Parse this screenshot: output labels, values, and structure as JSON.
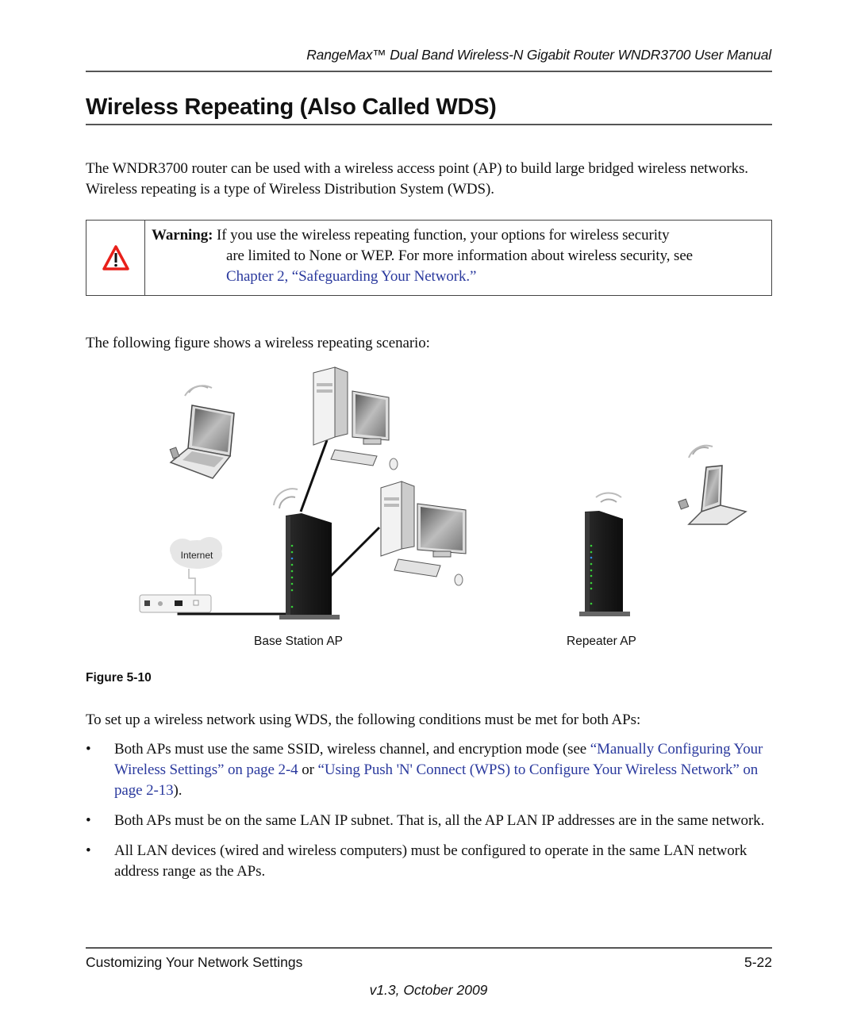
{
  "header": {
    "running_title": "RangeMax™ Dual Band Wireless-N Gigabit Router WNDR3700 User Manual"
  },
  "section": {
    "title": "Wireless Repeating (Also Called WDS)"
  },
  "intro_paragraph": "The WNDR3700 router can be used with a wireless access point (AP) to build large bridged wireless networks. Wireless repeating is a type of Wireless Distribution System (WDS).",
  "warning": {
    "icon": "warning-triangle-icon",
    "label": "Warning:",
    "line1": "If you use the wireless repeating function, your options for wireless security",
    "line2": "are limited to None or WEP. For more information about wireless security, see",
    "link_text": "Chapter 2, “Safeguarding Your Network.”",
    "icon_color": "#e8201a",
    "link_color": "#2b3a9e"
  },
  "figure_intro": "The following figure shows a wireless repeating scenario:",
  "figure": {
    "cloud_label": "Internet",
    "caption_base": "Base Station AP",
    "caption_repeater": "Repeater AP",
    "label": "Figure 5-10",
    "devices": [
      "laptop",
      "desktop-pc",
      "desktop-pc",
      "modem",
      "base-station-router",
      "repeater-router",
      "laptop"
    ]
  },
  "conditions_intro": "To set up a wireless network using WDS, the following conditions must be met for both APs:",
  "bullets": [
    {
      "bullet": "•",
      "pre": "Both APs must use the same SSID, wireless channel, and encryption mode (see ",
      "link1": "“Manually Configuring Your Wireless Settings” on page 2-4",
      "mid": " or ",
      "link2": "“Using Push 'N' Connect (WPS) to Configure Your Wireless Network” on page 2-13",
      "post": ")."
    },
    {
      "bullet": "•",
      "text": "Both APs must be on the same LAN IP subnet. That is, all the AP LAN IP addresses are in the same network."
    },
    {
      "bullet": "•",
      "text": "All LAN devices (wired and wireless computers) must be configured to operate in the same LAN network address range as the APs."
    }
  ],
  "footer": {
    "chapter": "Customizing Your Network Settings",
    "page": "5-22",
    "version": "v1.3, October 2009"
  }
}
